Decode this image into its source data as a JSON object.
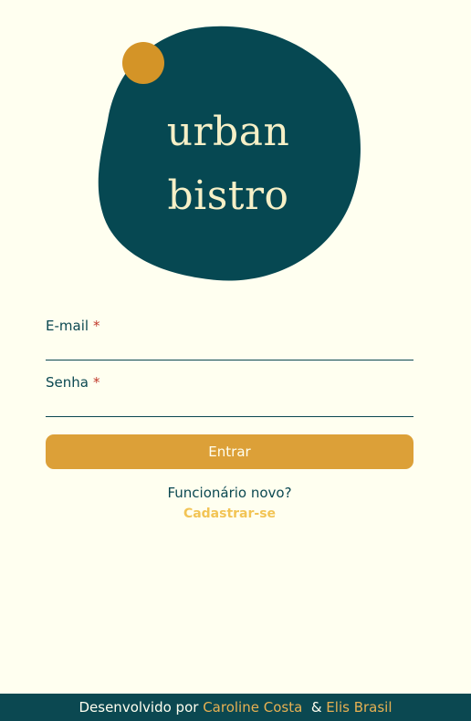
{
  "brand": {
    "line1": "urban",
    "line2": "bistro",
    "blob_color": "#064852",
    "dot_color": "#d49427",
    "text_color": "#f6f0c7"
  },
  "form": {
    "email_label": "E-mail",
    "password_label": "Senha",
    "required_marker": "*",
    "email_value": "",
    "password_value": "",
    "submit_label": "Entrar"
  },
  "signup": {
    "prompt": "Funcionário novo?",
    "link_label": "Cadastrar-se"
  },
  "footer": {
    "prefix": "Desenvolvido por",
    "author1": "Caroline Costa",
    "separator": "&",
    "author2": "Elis Brasil"
  },
  "colors": {
    "background": "#fffff0",
    "primary": "#0b4851",
    "accent": "#dca038",
    "link": "#f2c455",
    "required": "#c0392b"
  }
}
